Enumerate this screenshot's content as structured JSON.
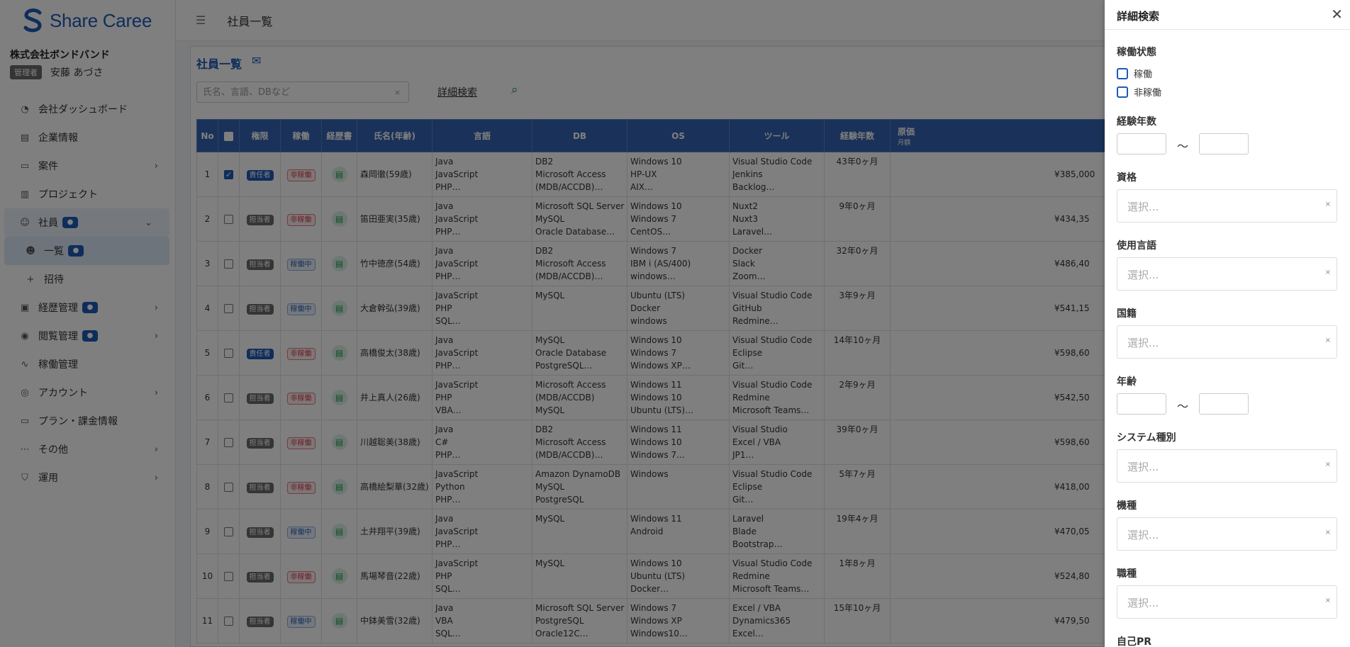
{
  "brand": {
    "name": "Share Caree",
    "color": "#1e5bb8"
  },
  "company": {
    "name": "株式会社ボンドバンド",
    "role": "管理者",
    "user": "安藤 あづさ"
  },
  "menu": [
    {
      "label": "会社ダッシュボード",
      "icon": "dashboard-icon"
    },
    {
      "label": "企業情報",
      "icon": "building-icon"
    },
    {
      "label": "案件",
      "icon": "briefcase-icon"
    },
    {
      "label": "プロジェクト",
      "icon": "project-icon"
    },
    {
      "label": "社員",
      "icon": "users-icon"
    },
    {
      "label": "一覧",
      "icon": "users-icon"
    },
    {
      "label": "招待",
      "icon": "user-plus-icon"
    },
    {
      "label": "経歴管理",
      "icon": "document-icon"
    },
    {
      "label": "閲覧管理",
      "icon": "eye-icon"
    },
    {
      "label": "稼働管理",
      "icon": "activity-icon"
    },
    {
      "label": "アカウント",
      "icon": "account-icon"
    },
    {
      "label": "プラン・課金情報",
      "icon": "card-icon"
    },
    {
      "label": "その他",
      "icon": "more-icon"
    },
    {
      "label": "運用",
      "icon": "shield-icon"
    }
  ],
  "header": {
    "title": "社員一覧"
  },
  "main": {
    "title": "社員一覧",
    "search_placeholder": "氏名、言語、DBなど",
    "advanced_search": "詳細検索"
  },
  "table": {
    "headers": {
      "no": "No",
      "role": "権限",
      "status": "稼働",
      "resume": "経歴書",
      "name": "氏名(年齢)",
      "lang": "言語",
      "db": "DB",
      "os": "OS",
      "tool": "ツール",
      "exp": "経験年数",
      "price": "原価",
      "price_sub": "月額"
    },
    "rows": [
      {
        "no": "1",
        "checked": true,
        "role": "責任者",
        "status": "非稼働",
        "name": "森岡徹(59歳)",
        "lang": [
          "Java",
          "JavaScript",
          "PHP…"
        ],
        "db": [
          "DB2",
          "Microsoft Access",
          "(MDB/ACCDB)…"
        ],
        "os": [
          "Windows 10",
          "HP-UX",
          "AIX…"
        ],
        "tool": [
          "Visual Studio Code",
          "Jenkins",
          "Backlog…"
        ],
        "exp": "43年0ヶ月",
        "price": "¥385,000"
      },
      {
        "no": "2",
        "checked": false,
        "role": "担当者",
        "status": "非稼働",
        "name": "笛田亜実(35歳)",
        "lang": [
          "Java",
          "JavaScript",
          "PHP…"
        ],
        "db": [
          "Microsoft SQL Server",
          "MySQL",
          "Oracle Database…"
        ],
        "os": [
          "Windows 10",
          "Windows 7",
          "CentOS…"
        ],
        "tool": [
          "Nuxt2",
          "Nuxt3",
          "Laravel…"
        ],
        "exp": "9年0ヶ月",
        "price": "¥434,35"
      },
      {
        "no": "3",
        "checked": false,
        "role": "担当者",
        "status": "稼働中",
        "name": "竹中徳彦(54歳)",
        "lang": [
          "Java",
          "JavaScript",
          "PHP…"
        ],
        "db": [
          "DB2",
          "Microsoft Access",
          "(MDB/ACCDB)…"
        ],
        "os": [
          "Windows 7",
          "IBM i (AS/400)",
          "windows…"
        ],
        "tool": [
          "Docker",
          "Slack",
          "Zoom…"
        ],
        "exp": "32年0ヶ月",
        "price": "¥486,40"
      },
      {
        "no": "4",
        "checked": false,
        "role": "担当者",
        "status": "稼働中",
        "name": "大倉幹弘(39歳)",
        "lang": [
          "JavaScript",
          "PHP",
          "SQL…"
        ],
        "db": [
          "MySQL"
        ],
        "os": [
          "Ubuntu (LTS)",
          "Docker",
          "windows"
        ],
        "tool": [
          "Visual Studio Code",
          "GitHub",
          "Redmine…"
        ],
        "exp": "3年9ヶ月",
        "price": "¥541,15"
      },
      {
        "no": "5",
        "checked": false,
        "role": "責任者",
        "status": "非稼働",
        "name": "高橋俊太(38歳)",
        "lang": [
          "Java",
          "JavaScript",
          "PHP…"
        ],
        "db": [
          "MySQL",
          "Oracle Database",
          "PostgreSQL…"
        ],
        "os": [
          "Windows 10",
          "Windows 7",
          "Windows XP…"
        ],
        "tool": [
          "Visual Studio Code",
          "Eclipse",
          "Git…"
        ],
        "exp": "14年10ヶ月",
        "price": "¥598,60"
      },
      {
        "no": "6",
        "checked": false,
        "role": "担当者",
        "status": "非稼働",
        "name": "井上真人(26歳)",
        "lang": [
          "JavaScript",
          "PHP",
          "VBA…"
        ],
        "db": [
          "Microsoft Access",
          "(MDB/ACCDB)",
          "MySQL"
        ],
        "os": [
          "Windows 11",
          "Windows 10",
          "Ubuntu (LTS)…"
        ],
        "tool": [
          "Visual Studio Code",
          "Redmine",
          "Microsoft Teams…"
        ],
        "exp": "2年9ヶ月",
        "price": "¥542,50"
      },
      {
        "no": "7",
        "checked": false,
        "role": "担当者",
        "status": "非稼働",
        "name": "川越聡美(38歳)",
        "lang": [
          "Java",
          "C#",
          "PHP…"
        ],
        "db": [
          "DB2",
          "Microsoft Access",
          "(MDB/ACCDB)…"
        ],
        "os": [
          "Windows 11",
          "Windows 10",
          "Windows 7…"
        ],
        "tool": [
          "Visual Studio",
          "Excel / VBA",
          "JP1…"
        ],
        "exp": "39年0ヶ月",
        "price": "¥598,60"
      },
      {
        "no": "8",
        "checked": false,
        "role": "担当者",
        "status": "非稼働",
        "name": "高橋絵梨華(32歳)",
        "lang": [
          "JavaScript",
          "Python",
          "PHP…"
        ],
        "db": [
          "Amazon DynamoDB",
          "MySQL",
          "PostgreSQL"
        ],
        "os": [
          "Windows"
        ],
        "tool": [
          "Visual Studio Code",
          "Eclipse",
          "Git…"
        ],
        "exp": "5年7ヶ月",
        "price": "¥418,00"
      },
      {
        "no": "9",
        "checked": false,
        "role": "担当者",
        "status": "稼働中",
        "name": "土井翔平(39歳)",
        "lang": [
          "Java",
          "JavaScript",
          "PHP…"
        ],
        "db": [
          "MySQL"
        ],
        "os": [
          "Windows 11",
          "Android"
        ],
        "tool": [
          "Laravel",
          "Blade",
          "Bootstrap…"
        ],
        "exp": "19年4ヶ月",
        "price": "¥470,05"
      },
      {
        "no": "10",
        "checked": false,
        "role": "担当者",
        "status": "非稼働",
        "name": "馬場琴音(22歳)",
        "lang": [
          "JavaScript",
          "PHP",
          "SQL…"
        ],
        "db": [
          "MySQL"
        ],
        "os": [
          "Windows 10",
          "Ubuntu (LTS)",
          "Docker…"
        ],
        "tool": [
          "Visual Studio Code",
          "Redmine",
          "Microsoft Teams…"
        ],
        "exp": "1年8ヶ月",
        "price": "¥524,80"
      },
      {
        "no": "11",
        "checked": false,
        "role": "担当者",
        "status": "稼働中",
        "name": "中鉢美雪(32歳)",
        "lang": [
          "Java",
          "VBA",
          "SQL…"
        ],
        "db": [
          "Microsoft SQL Server",
          "PostgreSQL",
          "Oracle12C…"
        ],
        "os": [
          "Windows 7",
          "Windows XP",
          "Windows10…"
        ],
        "tool": [
          "Excel / VBA",
          "Dynamics365",
          "Excel…"
        ],
        "exp": "15年10ヶ月",
        "price": "¥479,50"
      }
    ]
  },
  "drawer": {
    "title": "詳細検索",
    "status_label": "稼働状態",
    "status_options": [
      "稼働",
      "非稼働"
    ],
    "experience_label": "経験年数",
    "tilde": "〜",
    "qualification_label": "資格",
    "language_label": "使用言語",
    "nationality_label": "国籍",
    "age_label": "年齢",
    "system_label": "システム種別",
    "device_label": "機種",
    "job_label": "職種",
    "pr_label": "自己PR",
    "select_placeholder": "選択...",
    "clear": "×"
  }
}
